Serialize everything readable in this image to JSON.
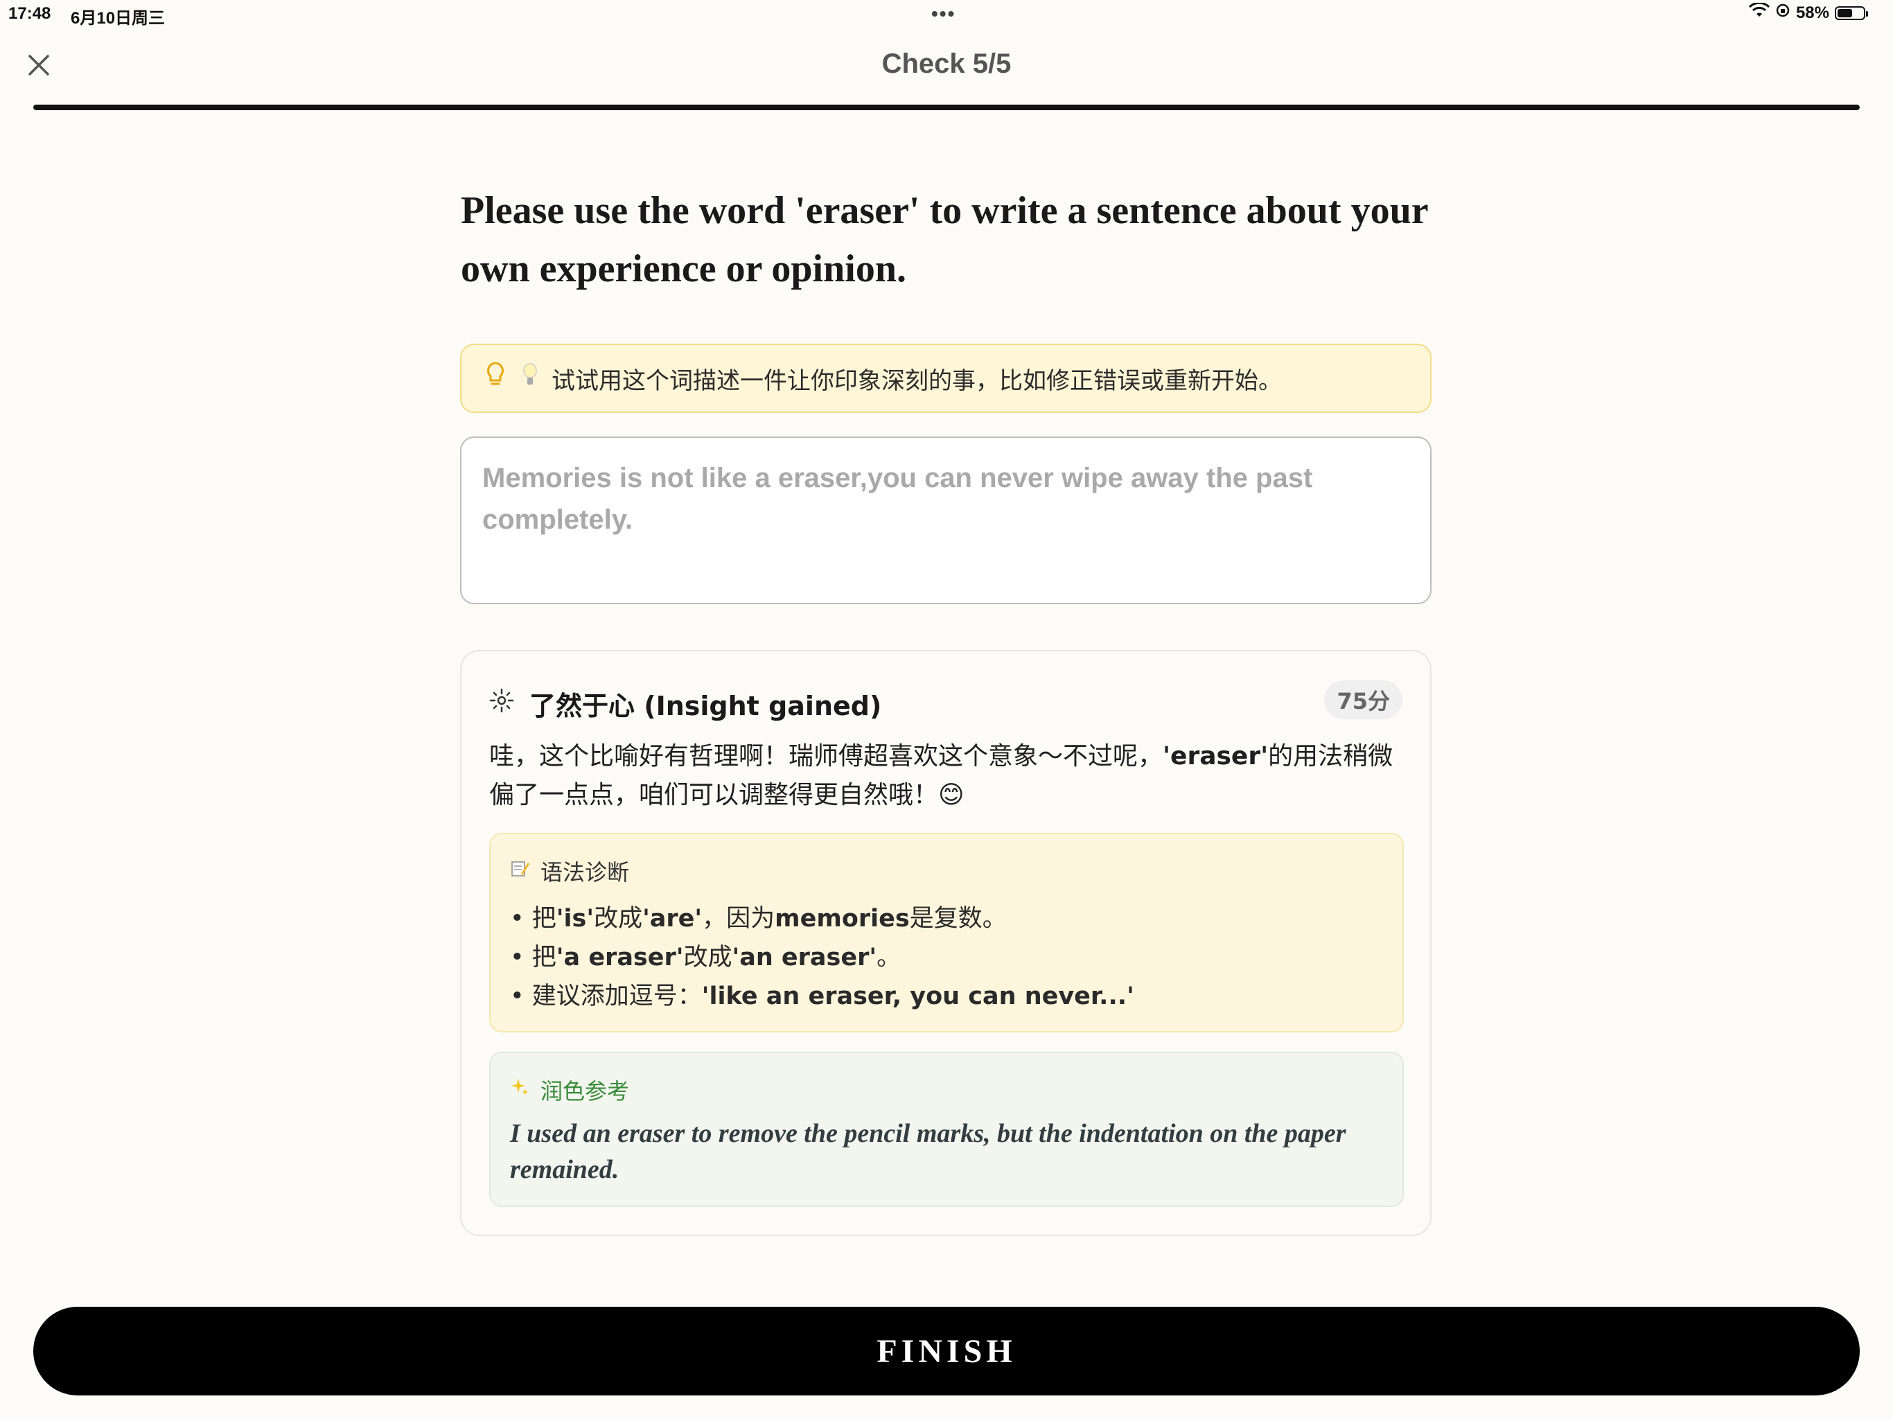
{
  "status_bar": {
    "time": "17:48",
    "date": "6月10日周三",
    "dots": "•••",
    "battery": "58%",
    "battery_level": 0.58
  },
  "header": {
    "title": "Check 5/5",
    "close_icon": "close-icon",
    "progress": 1.0
  },
  "question": {
    "text": "Please use the word 'eraser' to write a sentence about your own experience or opinion."
  },
  "hint": {
    "text": "试试用这个词描述一件让你印象深刻的事，比如修正错误或重新开始。"
  },
  "answer": {
    "value": "Memories is not like a eraser,you can never wipe away the past completely."
  },
  "feedback": {
    "title": "了然于心 (Insight gained)",
    "score": "75分",
    "body_pre": "哇，这个比喻好有哲理啊！瑞师傅超喜欢这个意象～不过呢，",
    "body_word": "'eraser'",
    "body_post": "的用法稍微偏了一点点，咱们可以调整得更自然哦！😊",
    "grammar": {
      "title": "语法诊断",
      "items": [
        {
          "pre": "把",
          "b1": "'is'",
          "mid": "改成",
          "b2": "'are'",
          "post1": "，因为",
          "b3": "memories",
          "post2": "是复数。"
        },
        {
          "pre": "把",
          "b1": "'a eraser'",
          "mid": "改成",
          "b2": "'an eraser'",
          "post1": "。",
          "b3": "",
          "post2": ""
        },
        {
          "pre": "建议添加逗号：",
          "b1": "'like an eraser, you can never...'",
          "mid": "",
          "b2": "",
          "post1": "",
          "b3": "",
          "post2": ""
        }
      ]
    },
    "polish": {
      "title": "润色参考",
      "text": "I used an eraser to remove the pencil marks, but the indentation on the paper remained."
    }
  },
  "finish": {
    "label": "FINISH"
  },
  "colors": {
    "background": "#fcfbf7",
    "hint_bg": "#fef6d6",
    "grammar_bg": "#fef6dc",
    "polish_bg": "#f2f6ef",
    "polish_title": "#3a8c3a",
    "button": "#000000"
  }
}
